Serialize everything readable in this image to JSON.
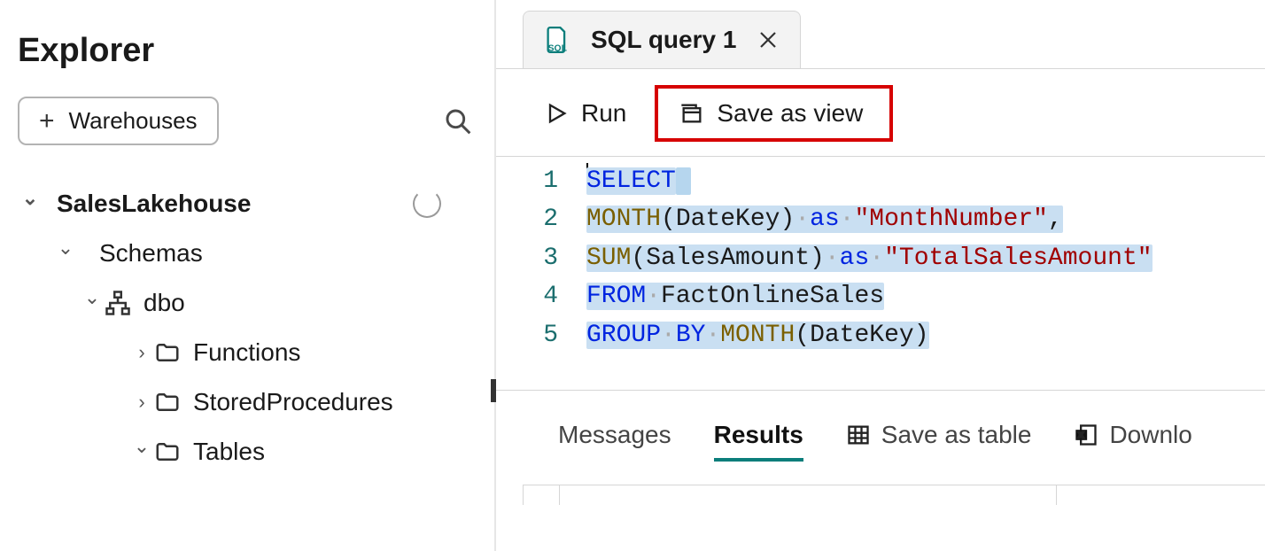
{
  "explorer": {
    "title": "Explorer",
    "add_button": "Warehouses",
    "tree": {
      "root": {
        "label": "SalesLakehouse",
        "loading": true
      },
      "schemas_label": "Schemas",
      "dbo_label": "dbo",
      "functions_label": "Functions",
      "sprocs_label": "StoredProcedures",
      "tables_label": "Tables"
    }
  },
  "tab": {
    "title": "SQL query 1"
  },
  "toolbar": {
    "run": "Run",
    "save_view": "Save as view"
  },
  "editor": {
    "lines": [
      "1",
      "2",
      "3",
      "4",
      "5"
    ],
    "l1": {
      "select": "SELECT"
    },
    "l2": {
      "month": "MONTH",
      "arg": "(DateKey)",
      "as": "as",
      "str": "\"MonthNumber\"",
      "comma": ","
    },
    "l3": {
      "sum": "SUM",
      "arg": "(SalesAmount)",
      "as": "as",
      "str": "\"TotalSalesAmount\""
    },
    "l4": {
      "from": "FROM",
      "tbl": "FactOnlineSales"
    },
    "l5": {
      "group": "GROUP",
      "by": "BY",
      "month": "MONTH",
      "arg": "(DateKey)"
    }
  },
  "results": {
    "messages": "Messages",
    "results": "Results",
    "save_table": "Save as table",
    "download": "Downlo"
  }
}
